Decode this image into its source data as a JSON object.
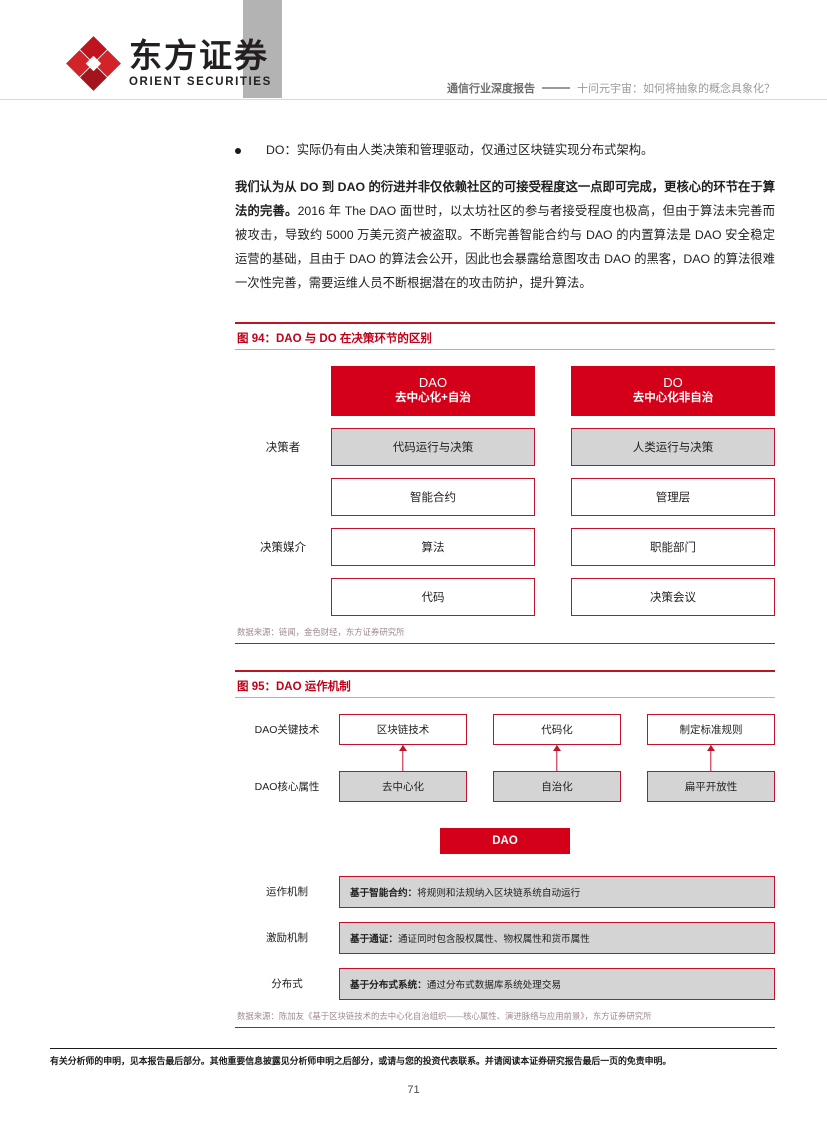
{
  "header": {
    "logo_cn": "东方证券",
    "logo_en": "ORIENT SECURITIES",
    "report_name": "通信行业深度报告",
    "dash": "——",
    "report_subtitle": "十问元宇宙：如何将抽象的概念具象化？"
  },
  "body": {
    "bullet": "DO：实际仍有由人类决策和管理驱动，仅通过区块链实现分布式架构。",
    "paragraph_bold_1": "我们认为从 DO 到 DAO 的衍进并非仅依赖社区的可接受程度这一点即可完成，更核心的环节在于算法的完善。",
    "paragraph_rest": "2016 年 The DAO 面世时，以太坊社区的参与者接受程度也极高，但由于算法未完善而被攻击，导致约 5000 万美元资产被盗取。不断完善智能合约与 DAO 的内置算法是 DAO 安全稳定运营的基础，且由于 DAO 的算法会公开，因此也会暴露给意图攻击 DAO 的黑客，DAO 的算法很难一次性完善，需要运维人员不断根据潜在的攻击防护，提升算法。"
  },
  "figure94": {
    "title": "图 94：DAO 与 DO 在决策环节的区别",
    "head_left_line1": "DAO",
    "head_left_line2": "去中心化+自治",
    "head_right_line1": "DO",
    "head_right_line2": "去中心化非自治",
    "row_labels": [
      "决策者",
      "",
      "决策媒介",
      ""
    ],
    "left_column": [
      "代码运行与决策",
      "智能合约",
      "算法",
      "代码"
    ],
    "right_column": [
      "人类运行与决策",
      "管理层",
      "职能部门",
      "决策会议"
    ],
    "source": "数据来源：链闻，金色财经，东方证券研究所"
  },
  "figure95": {
    "title": "图 95：DAO 运作机制",
    "row1_label": "DAO关键技术",
    "row2_label": "DAO核心属性",
    "tech_boxes": [
      "区块链技术",
      "代码化",
      "制定标准规则"
    ],
    "attr_boxes": [
      "去中心化",
      "自治化",
      "扁平开放性"
    ],
    "center_box": "DAO",
    "mechanisms": [
      {
        "label": "运作机制",
        "bold": "基于智能合约：",
        "text": "将规则和法规纳入区块链系统自动运行"
      },
      {
        "label": "激励机制",
        "bold": "基于通证：",
        "text": "通证同时包含股权属性、物权属性和货币属性"
      },
      {
        "label": "分布式",
        "bold": "基于分布式系统：",
        "text": "通过分布式数据库系统处理交易"
      }
    ],
    "source": "数据来源：陈加友《基于区块链技术的去中心化自治组织——核心属性、演进脉络与应用前景》，东方证券研究所"
  },
  "footer": {
    "disclaimer": "有关分析师的申明，见本报告最后部分。其他重要信息披露见分析师申明之后部分，或请与您的投资代表联系。并请阅读本证券研究报告最后一页的免责申明。",
    "page_number": "71"
  },
  "colors": {
    "brand_red": "#d40019",
    "title_red": "#c00018",
    "border_red": "#c0132b",
    "box_gray": "#d4d4d4",
    "header_bar_gray": "#b3b3b3"
  }
}
